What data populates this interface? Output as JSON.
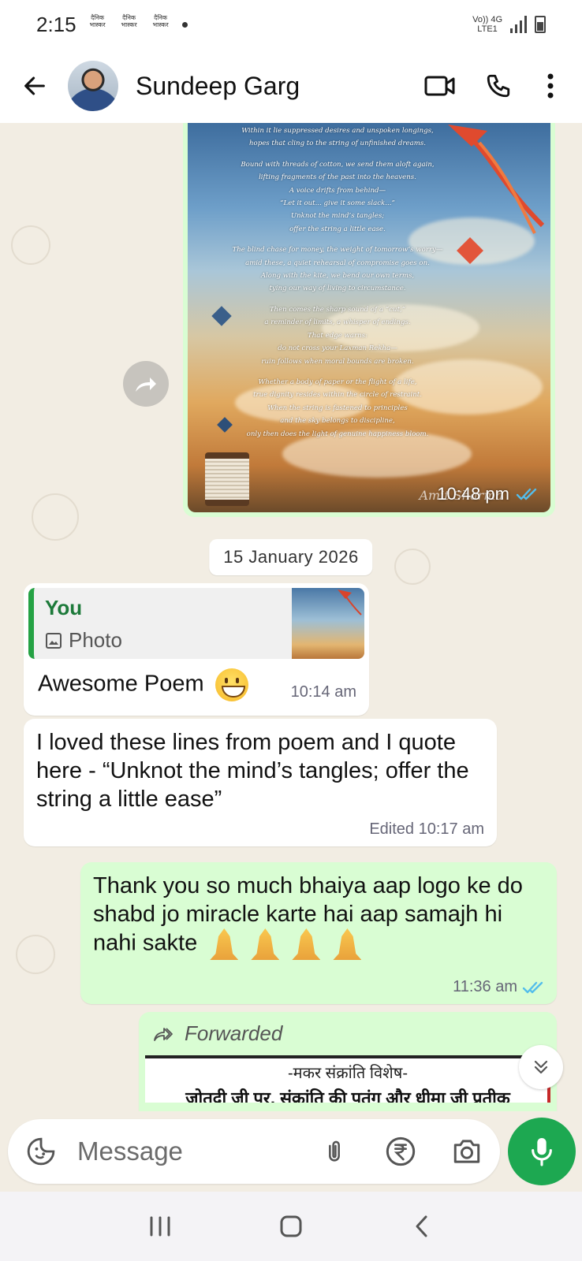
{
  "status_bar": {
    "time": "2:15",
    "notif_label": "दैनिक भास्कर",
    "network_line1": "Vo)) 4G",
    "network_line2": "LTE1"
  },
  "header": {
    "contact_name": "Sundeep Garg"
  },
  "image_message": {
    "poem_lines": [
      "Within it lie suppressed desires and unspoken longings,",
      "hopes that cling to the string of unfinished dreams.",
      "",
      "Bound with threads of cotton, we send them aloft again,",
      "lifting fragments of the past into the heavens.",
      "A voice drifts from behind—",
      "“Let it out... give it some slack...”",
      "Unknot the mind’s tangles;",
      "offer the string a little ease.",
      "",
      "The blind chase for money, the weight of tomorrow’s worry—",
      "amid these, a quiet rehearsal of compromise goes on.",
      "Along with the kite, we bend our own terms,",
      "tying our way of living to circumstance.",
      "",
      "Then comes the sharp sound of a “cut,”",
      "a reminder of limits, a whisper of endings.",
      "That edge warns:",
      "do not cross your Laxman Rekha—",
      "ruin follows when moral bounds are broken.",
      "",
      "Whether a body of paper or the flight of a life,",
      "true dignity resides within the circle of restraint.",
      "When the string is fastened to principles",
      "and the sky belongs to discipline,",
      "only then does the light of genuine happiness bloom."
    ],
    "signature": "Amit Sharma",
    "time": "10:48 pm"
  },
  "date_chip": "15 January 2026",
  "reply_message": {
    "quote_author": "You",
    "quote_type": "Photo",
    "text": "Awesome Poem",
    "time": "10:14 am"
  },
  "incoming_message": {
    "text": "I loved these lines from poem and I quote here  - “Unknot the mind’s tangles; offer the string a little ease”",
    "time": "Edited 10:17 am"
  },
  "outgoing_message": {
    "text": "Thank you so much bhaiya aap logo ke do shabd jo miracle karte hai aap samajh hi nahi sakte",
    "time": "11:36 am"
  },
  "forwarded_message": {
    "label": "Forwarded",
    "doc_title": "-मकर संक्रांति विशेष-",
    "doc_line2": "जोतदी जी पर, संक्रांति की पतंग और धीमा जी प्रतीक"
  },
  "input_bar": {
    "placeholder": "Message"
  },
  "colors": {
    "outgoing_bubble": "#d9fdd3",
    "incoming_bubble": "#ffffff",
    "accent_green": "#1da851",
    "read_tick": "#53bdeb"
  }
}
